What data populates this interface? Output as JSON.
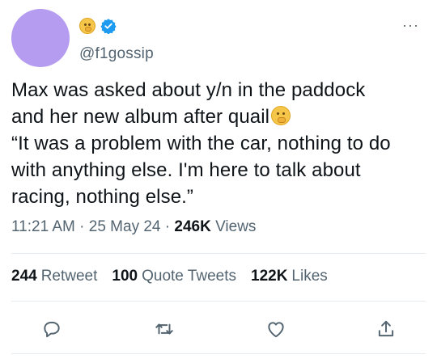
{
  "header": {
    "avatar_color": "#b69cf0",
    "display_emoji": "shushing-face-emoji",
    "verified_color": "#1d9bf0",
    "handle": "@f1gossip",
    "more_label": "···"
  },
  "tweet": {
    "lines": [
      "Max was asked about y/n in the paddock",
      "and her new album after quail",
      "“It was a problem with the car, nothing to do",
      "with anything else. I'm here to talk about",
      "racing, nothing else.”"
    ],
    "inline_emoji": "shushing-face-emoji"
  },
  "meta": {
    "time": "11:21 AM",
    "sep1": " · ",
    "date": "25 May 24",
    "sep2": " · ",
    "views_count": "246K",
    "views_label": " Views"
  },
  "stats": [
    {
      "count": "244",
      "label": "Retweet"
    },
    {
      "count": "100",
      "label": "Quote Tweets"
    },
    {
      "count": "122K",
      "label": "Likes"
    }
  ],
  "actions": [
    "reply-icon",
    "retweet-icon",
    "like-icon",
    "share-icon"
  ],
  "colors": {
    "text": "#0f1419",
    "secondary": "#536471",
    "accent": "#1d9bf0",
    "divider": "#e6ecf0"
  }
}
